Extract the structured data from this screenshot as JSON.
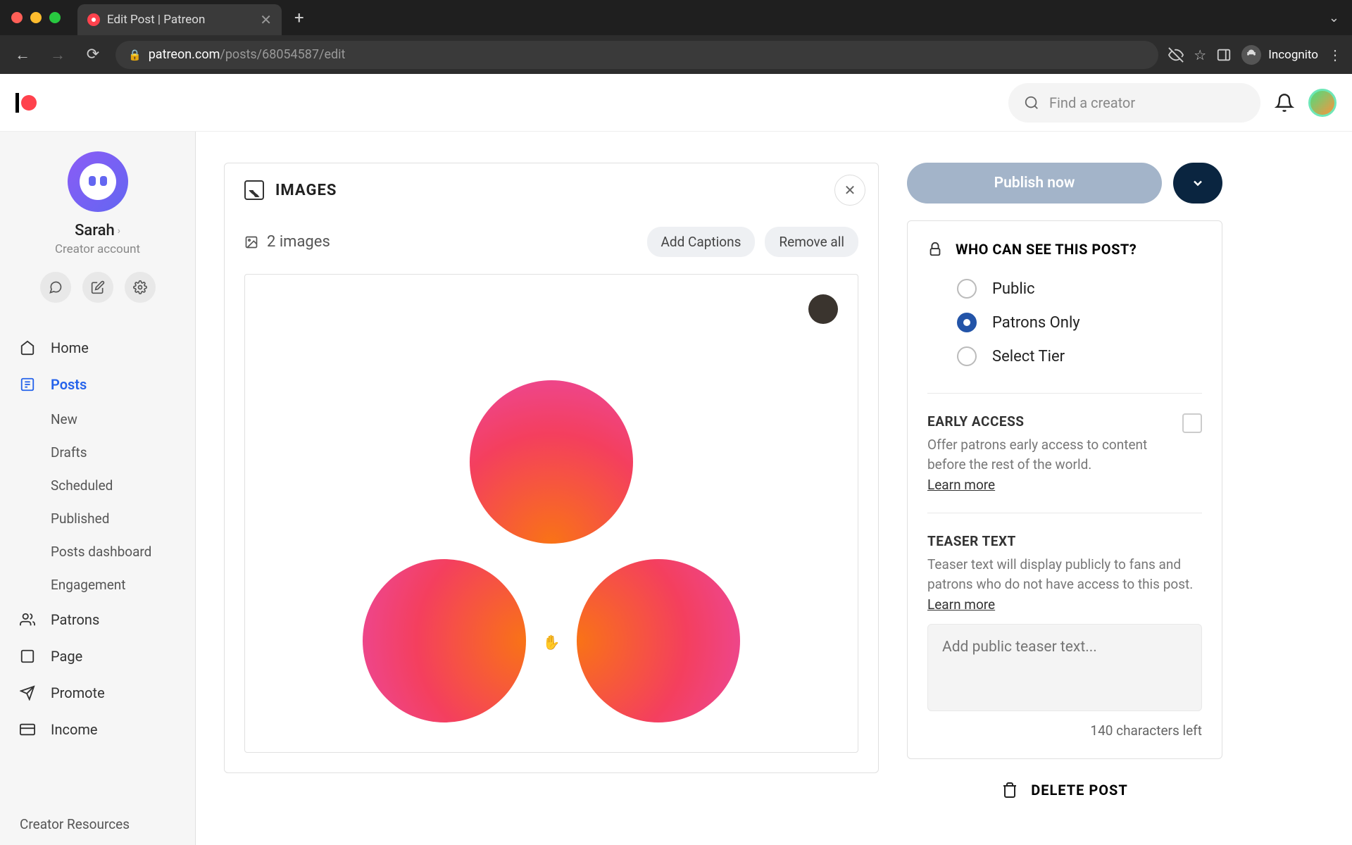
{
  "browser": {
    "tab_title": "Edit Post | Patreon",
    "url_host": "patreon.com",
    "url_path": "/posts/68054587/edit",
    "incognito_label": "Incognito"
  },
  "header": {
    "search_placeholder": "Find a creator"
  },
  "sidebar": {
    "profile_name": "Sarah",
    "profile_sub": "Creator account",
    "nav": {
      "home": "Home",
      "posts": "Posts",
      "new": "New",
      "drafts": "Drafts",
      "scheduled": "Scheduled",
      "published": "Published",
      "dashboard": "Posts dashboard",
      "engagement": "Engagement",
      "patrons": "Patrons",
      "page": "Page",
      "promote": "Promote",
      "income": "Income",
      "resources": "Creator Resources"
    }
  },
  "editor": {
    "panel_title": "IMAGES",
    "img_count_label": "2 images",
    "add_captions": "Add Captions",
    "remove_all": "Remove all"
  },
  "publish": {
    "button": "Publish now"
  },
  "visibility": {
    "title": "WHO CAN SEE THIS POST?",
    "public": "Public",
    "patrons": "Patrons Only",
    "select_tier": "Select Tier"
  },
  "early_access": {
    "title": "EARLY ACCESS",
    "desc": "Offer patrons early access to content before the rest of the world.",
    "learn": "Learn more"
  },
  "teaser": {
    "title": "TEASER TEXT",
    "desc": "Teaser text will display publicly to fans and patrons who do not have access to this post.",
    "learn": "Learn more",
    "placeholder": "Add public teaser text...",
    "chars_left": "140 characters left"
  },
  "delete_post": "DELETE POST"
}
